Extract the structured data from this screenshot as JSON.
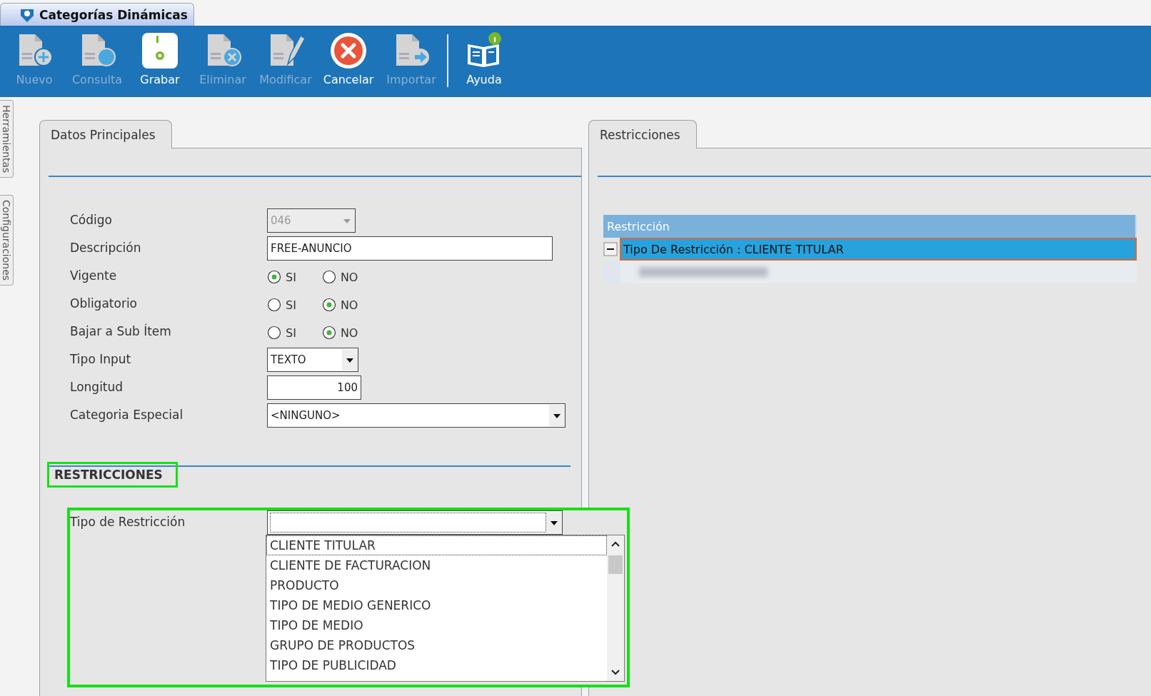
{
  "window": {
    "title": "Categorías Dinámicas"
  },
  "toolbar": [
    {
      "label": "Nuevo",
      "disabled": true,
      "separator_before": false
    },
    {
      "label": "Consulta",
      "disabled": true,
      "separator_before": false
    },
    {
      "label": "Grabar",
      "disabled": false,
      "separator_before": false
    },
    {
      "label": "Eliminar",
      "disabled": true,
      "separator_before": false
    },
    {
      "label": "Modificar",
      "disabled": true,
      "separator_before": false
    },
    {
      "label": "Cancelar",
      "disabled": false,
      "separator_before": false
    },
    {
      "label": "Importar",
      "disabled": true,
      "separator_before": false
    },
    {
      "label": "Ayuda",
      "disabled": false,
      "separator_before": true
    }
  ],
  "side_tabs": [
    "Herramientas",
    "Configuraciones"
  ],
  "main_panel": {
    "tab": "Datos Principales",
    "fields": [
      {
        "kind": "select",
        "label": "Código",
        "value": "046",
        "disabled": true
      },
      {
        "kind": "text",
        "label": "Descripción",
        "value": "FREE-ANUNCIO"
      },
      {
        "kind": "radio",
        "label": "Vigente",
        "options": [
          {
            "label": "SI",
            "selected": true
          },
          {
            "label": "NO",
            "selected": false
          }
        ]
      },
      {
        "kind": "radio",
        "label": "Obligatorio",
        "options": [
          {
            "label": "SI",
            "selected": false
          },
          {
            "label": "NO",
            "selected": true
          }
        ]
      },
      {
        "kind": "radio",
        "label": "Bajar a Sub Ítem",
        "options": [
          {
            "label": "SI",
            "selected": false
          },
          {
            "label": "NO",
            "selected": true
          }
        ]
      },
      {
        "kind": "select",
        "label": "Tipo Input",
        "value": "TEXTO",
        "disabled": false
      },
      {
        "kind": "number",
        "label": "Longitud",
        "value": "100"
      },
      {
        "kind": "select",
        "label": "Categoria Especial",
        "value": "<NINGUNO>",
        "disabled": false
      }
    ],
    "section": {
      "title": "RESTRICCIONES",
      "highlighted": true,
      "field": {
        "label": "Tipo de Restricción",
        "highlighted": true,
        "open": true,
        "options": [
          {
            "label": "CLIENTE TITULAR",
            "focused": true
          },
          {
            "label": "CLIENTE DE FACTURACION",
            "focused": false
          },
          {
            "label": "PRODUCTO",
            "focused": false
          },
          {
            "label": "TIPO DE MEDIO GENERICO",
            "focused": false
          },
          {
            "label": "TIPO DE MEDIO",
            "focused": false
          },
          {
            "label": "GRUPO DE PRODUCTOS",
            "focused": false
          },
          {
            "label": "TIPO DE PUBLICIDAD",
            "focused": false
          }
        ]
      }
    }
  },
  "side_panel": {
    "tab": "Restricciones",
    "grid": {
      "column": "Restricción",
      "rows": [
        {
          "label": "Tipo De Restricción : CLIENTE TITULAR",
          "expanded": true,
          "selected": true,
          "children": [
            {
              "kind": "redacted"
            }
          ]
        }
      ]
    }
  }
}
